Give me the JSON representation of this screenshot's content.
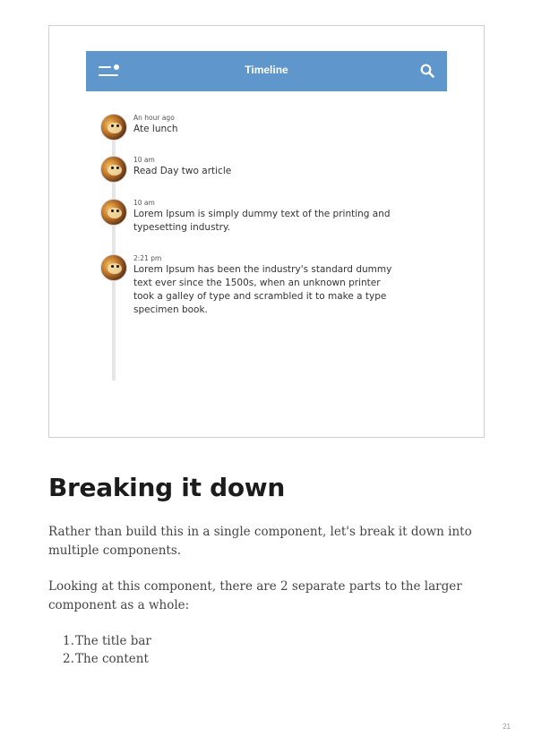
{
  "app": {
    "title": "Timeline",
    "icons": {
      "menu": "menu-icon",
      "search": "search-icon"
    },
    "header_color": "#5f96cc",
    "events": [
      {
        "time": "An hour ago",
        "text": "Ate lunch"
      },
      {
        "time": "10 am",
        "text": "Read Day two article"
      },
      {
        "time": "10 am",
        "text": "Lorem Ipsum is simply dummy text of the printing and typesetting industry."
      },
      {
        "time": "2:21 pm",
        "text": "Lorem Ipsum has been the industry's standard dummy text ever since the 1500s, when an unknown printer took a galley of type and scrambled it to make a type specimen book."
      }
    ]
  },
  "document": {
    "heading": "Breaking it down",
    "paragraphs": [
      "Rather than build this in a single component, let's break it down into multiple components.",
      "Looking at this component, there are 2 separate parts to the larger component as a whole:"
    ],
    "list": [
      {
        "num": "1.",
        "text": "The title bar"
      },
      {
        "num": "2.",
        "text": "The content"
      }
    ],
    "page_number": "21"
  }
}
